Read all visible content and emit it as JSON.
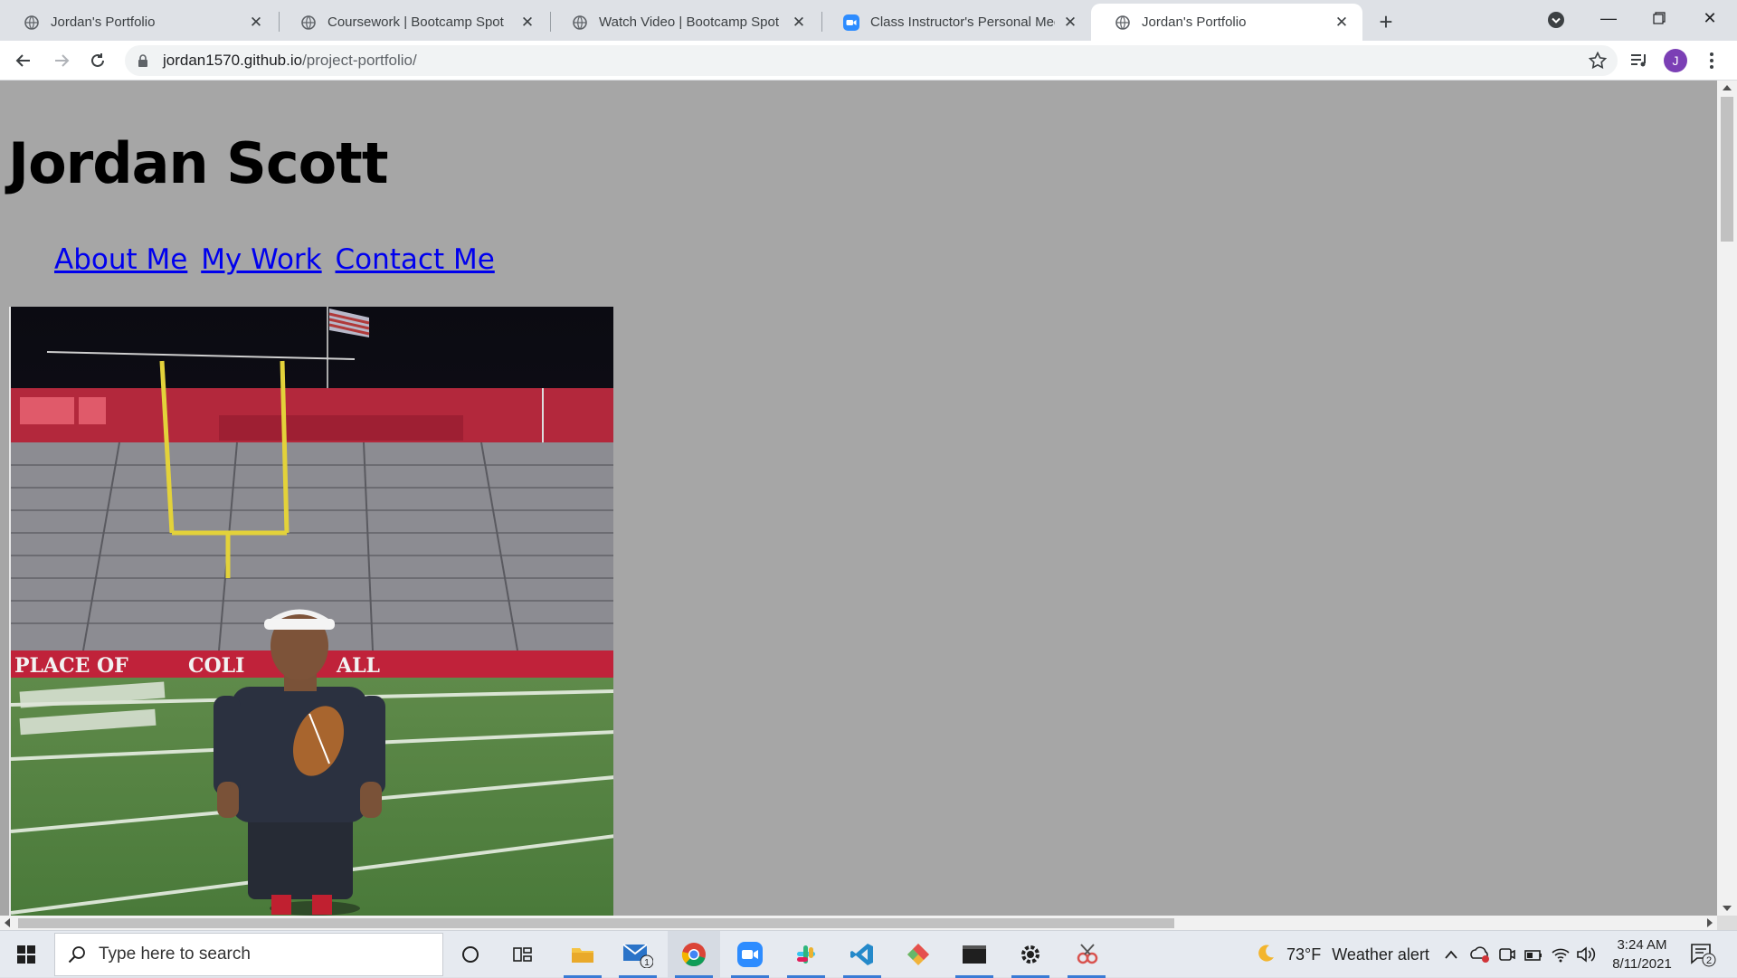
{
  "browser": {
    "tabs": [
      {
        "title": "Jordan's Portfolio",
        "icon": "globe-icon",
        "active": false
      },
      {
        "title": "Coursework | Bootcamp Spot",
        "icon": "globe-icon",
        "active": false
      },
      {
        "title": "Watch Video | Bootcamp Spot",
        "icon": "globe-icon",
        "active": false
      },
      {
        "title": "Class Instructor's Personal Meetin",
        "icon": "zoom-icon",
        "active": false
      },
      {
        "title": "Jordan's Portfolio",
        "icon": "globe-icon",
        "active": true
      }
    ],
    "url_host": "jordan1570.github.io",
    "url_path": "/project-portfolio/",
    "profile_initial": "J",
    "profile_color": "#7b3fb5"
  },
  "page": {
    "title": "Jordan Scott",
    "nav": [
      {
        "label": "About Me"
      },
      {
        "label": "My Work"
      },
      {
        "label": "Contact Me"
      }
    ],
    "background": "#a6a6a6",
    "link_color": "#0000ee",
    "photo": {
      "banner_text_left": "PLACE OF",
      "banner_text_mid": "COLI",
      "banner_text_right": "ALL"
    }
  },
  "taskbar": {
    "search_placeholder": "Type here to search",
    "weather_temp": "73°F",
    "weather_text": "Weather alert",
    "time": "3:24 AM",
    "date": "8/11/2021",
    "mail_badge": "1",
    "notification_count": "2"
  }
}
